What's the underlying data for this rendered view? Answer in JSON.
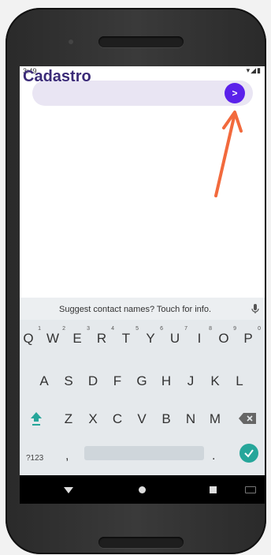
{
  "status": {
    "time": "3:49",
    "icons": "▾◢▮"
  },
  "app": {
    "title": "Cadastro"
  },
  "send": {
    "label": ">"
  },
  "keyboard": {
    "suggestion": "Suggest contact names? Touch for info.",
    "row1": [
      {
        "k": "Q",
        "n": "1"
      },
      {
        "k": "W",
        "n": "2"
      },
      {
        "k": "E",
        "n": "3"
      },
      {
        "k": "R",
        "n": "4"
      },
      {
        "k": "T",
        "n": "5"
      },
      {
        "k": "Y",
        "n": "6"
      },
      {
        "k": "U",
        "n": "7"
      },
      {
        "k": "I",
        "n": "8"
      },
      {
        "k": "O",
        "n": "9"
      },
      {
        "k": "P",
        "n": "0"
      }
    ],
    "row2": [
      "A",
      "S",
      "D",
      "F",
      "G",
      "H",
      "J",
      "K",
      "L"
    ],
    "row3": [
      "Z",
      "X",
      "C",
      "V",
      "B",
      "N",
      "M"
    ],
    "mode_label": "?123",
    "comma": ",",
    "period": "."
  },
  "colors": {
    "accent": "#5b21ea",
    "title": "#3b2b78",
    "done": "#26a69a",
    "arrow": "#f26a3d"
  }
}
